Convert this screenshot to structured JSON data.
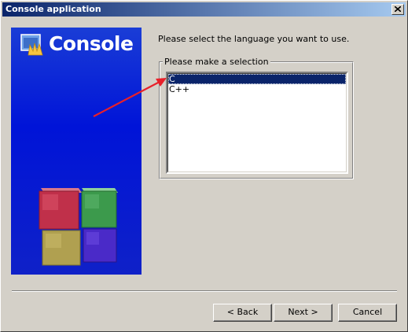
{
  "window": {
    "title": "Console application"
  },
  "banner": {
    "title": "Console"
  },
  "prompt": "Please select the language you want to use.",
  "selection_group": {
    "legend": "Please make a selection",
    "items": [
      {
        "label": "C",
        "selected": true
      },
      {
        "label": "C++",
        "selected": false
      }
    ]
  },
  "buttons": {
    "back": "< Back",
    "next": "Next >",
    "cancel": "Cancel"
  },
  "colors": {
    "titlebar_start": "#0a246a",
    "titlebar_end": "#a6caf0",
    "banner_blue": "#0014d8",
    "selection": "#0a246a",
    "arrow": "#e8202a",
    "dialog_face": "#d4d0c8"
  },
  "icons": {
    "close": "close-icon",
    "banner": "console-app-icon",
    "logo": "cubes-logo-icon"
  }
}
